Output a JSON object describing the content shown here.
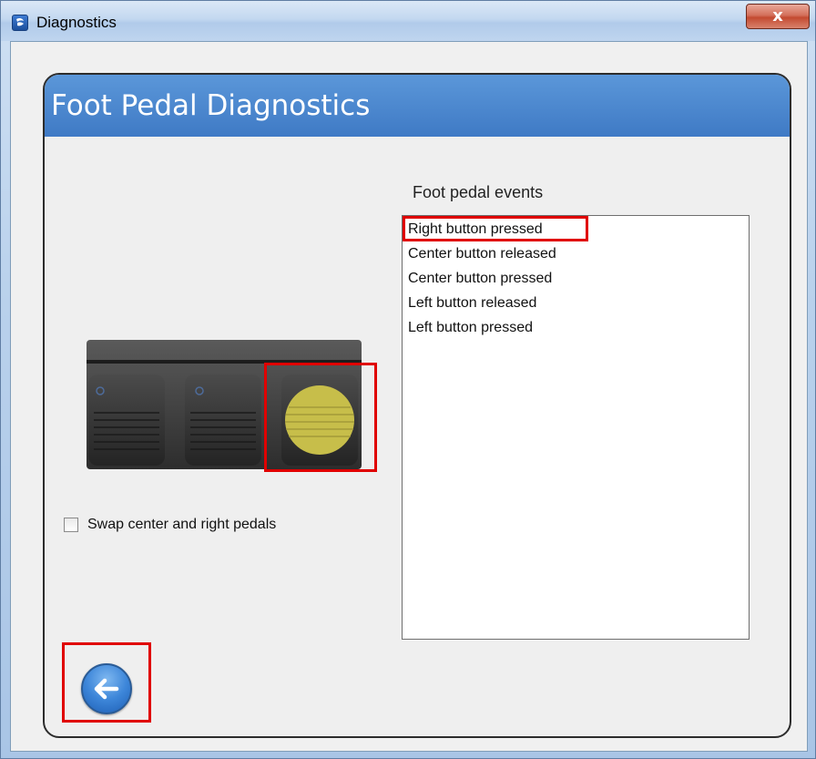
{
  "window": {
    "title": "Diagnostics",
    "close_label": "x"
  },
  "panel": {
    "title": "Foot Pedal Diagnostics"
  },
  "events": {
    "label": "Foot pedal events",
    "items": [
      "Right button pressed",
      "Center button released",
      "Center button pressed",
      "Left button released",
      "Left button pressed"
    ]
  },
  "options": {
    "swap_label": "Swap center and right pedals",
    "swap_checked": false
  },
  "pedals": {
    "active": "right",
    "active_color": "#c7be4a"
  },
  "colors": {
    "header": "#4a86cf",
    "highlight": "#e00000"
  }
}
